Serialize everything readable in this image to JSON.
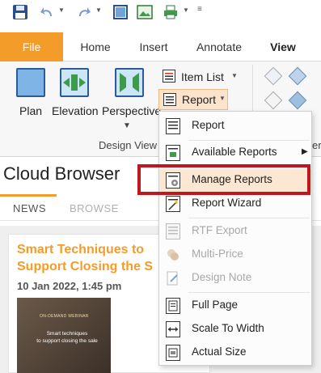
{
  "quick_access": {
    "icons": [
      "save-icon",
      "undo-icon",
      "redo-icon",
      "window-icon",
      "image-icon",
      "print-icon"
    ]
  },
  "tabs": [
    {
      "label": "File"
    },
    {
      "label": "Home"
    },
    {
      "label": "Insert"
    },
    {
      "label": "Annotate"
    },
    {
      "label": "View"
    }
  ],
  "ribbon": {
    "plan_label": "Plan",
    "elevation_label": "Elevation",
    "perspective_label": "Perspective",
    "group_label": "Design View",
    "item_list_label": "Item List",
    "report_label": "Report",
    "right_group_label": "er"
  },
  "report_menu": {
    "items": [
      {
        "label": "Report",
        "enabled": true
      },
      {
        "label": "Available Reports",
        "enabled": true
      },
      {
        "label": "Manage Reports",
        "enabled": true
      },
      {
        "label": "Report Wizard",
        "enabled": true
      },
      {
        "label": "RTF Export",
        "enabled": false
      },
      {
        "label": "Multi-Price",
        "enabled": false
      },
      {
        "label": "Design Note",
        "enabled": false
      },
      {
        "label": "Full Page",
        "enabled": true
      },
      {
        "label": "Scale To Width",
        "enabled": true
      },
      {
        "label": "Actual Size",
        "enabled": true
      }
    ]
  },
  "cloud_browser": {
    "title": "Cloud Browser",
    "tabs": [
      "NEWS",
      "BROWSE"
    ],
    "card": {
      "title": "Smart Techniques to\nSupport Closing the S",
      "date": "10 Jan 2022, 1:45 pm",
      "thumb_small": "ON-DEMAND WEBINAR",
      "thumb_text": "Smart techniques\nto support closing the sale"
    }
  },
  "colors": {
    "accent": "#f39c29",
    "highlight": "#c0161e"
  }
}
